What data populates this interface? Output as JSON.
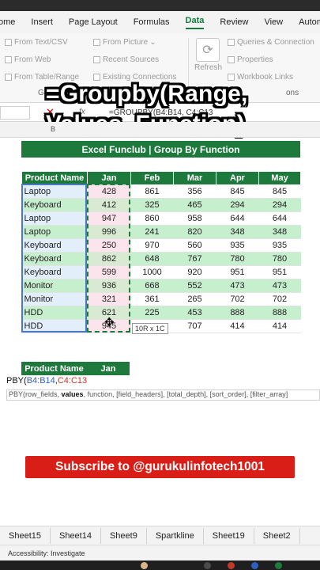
{
  "ribbon": {
    "tabs": [
      {
        "label": "ome",
        "active": false
      },
      {
        "label": "Insert",
        "active": false
      },
      {
        "label": "Page Layout",
        "active": false
      },
      {
        "label": "Formulas",
        "active": false
      },
      {
        "label": "Data",
        "active": true
      },
      {
        "label": "Review",
        "active": false
      },
      {
        "label": "View",
        "active": false
      },
      {
        "label": "Autom",
        "active": false
      }
    ],
    "group1": {
      "from_text_csv": "From Text/CSV",
      "from_web": "From Web",
      "from_table": "From Table/Range",
      "group_label": "Get &"
    },
    "group2": {
      "from_picture": "From Picture",
      "recent_sources": "Recent Sources",
      "existing_connections": "Existing Connections"
    },
    "refresh": "Refresh",
    "group3": {
      "queries": "Queries & Connection",
      "properties": "Properties",
      "workbook_links": "Workbook Links",
      "group_label": "ons"
    }
  },
  "overlay_title": "=Groupby(Range, Values, Function)",
  "formula_bar": {
    "name_box": "",
    "fx": "fx",
    "text": "=GROUPBY(B4:B14, C4:C13"
  },
  "col_headers": {
    "b": "B"
  },
  "sheet_title": "Excel Funclub | Group By Function",
  "table": {
    "headers": [
      "Product Name",
      "Jan",
      "Feb",
      "Mar",
      "Apr",
      "May"
    ],
    "rows": [
      [
        "Laptop",
        "428",
        "861",
        "356",
        "845",
        "845"
      ],
      [
        "Keyboard",
        "412",
        "325",
        "465",
        "294",
        "294"
      ],
      [
        "Laptop",
        "947",
        "860",
        "958",
        "644",
        "644"
      ],
      [
        "Laptop",
        "996",
        "241",
        "820",
        "348",
        "348"
      ],
      [
        "Keyboard",
        "250",
        "970",
        "560",
        "935",
        "935"
      ],
      [
        "Keyboard",
        "862",
        "648",
        "767",
        "780",
        "780"
      ],
      [
        "Keyboard",
        "599",
        "1000",
        "920",
        "951",
        "951"
      ],
      [
        "Monitor",
        "936",
        "668",
        "552",
        "473",
        "473"
      ],
      [
        "Monitor",
        "321",
        "361",
        "265",
        "702",
        "702"
      ],
      [
        "HDD",
        "621",
        "225",
        "453",
        "888",
        "888"
      ],
      [
        "HDD",
        "945",
        "",
        "707",
        "414",
        "414"
      ]
    ]
  },
  "selection_tooltip": "10R x 1C",
  "output": {
    "headers": [
      "Product Name",
      "Jan"
    ],
    "formula_prefix": "PBY(",
    "formula_range1": "B4:B14",
    "formula_comma": ",",
    "formula_range2": "C4:C13",
    "hint_prefix": "PBY(row_fields, ",
    "hint_bold": "values",
    "hint_rest": ", function, [field_headers], [total_depth], [sort_order], [filter_array]"
  },
  "subscribe": "Subscribe to @gurukulinfotech1001",
  "sheet_tabs": [
    "Sheet15",
    "Sheet14",
    "Sheet9",
    "Spartkline",
    "Sheet19",
    "Sheet2"
  ],
  "status": "Accessibility: Investigate",
  "colors": {
    "excel_green": "#1e7a3c",
    "banner_red": "#d91e18",
    "light_green": "#c6efce"
  }
}
